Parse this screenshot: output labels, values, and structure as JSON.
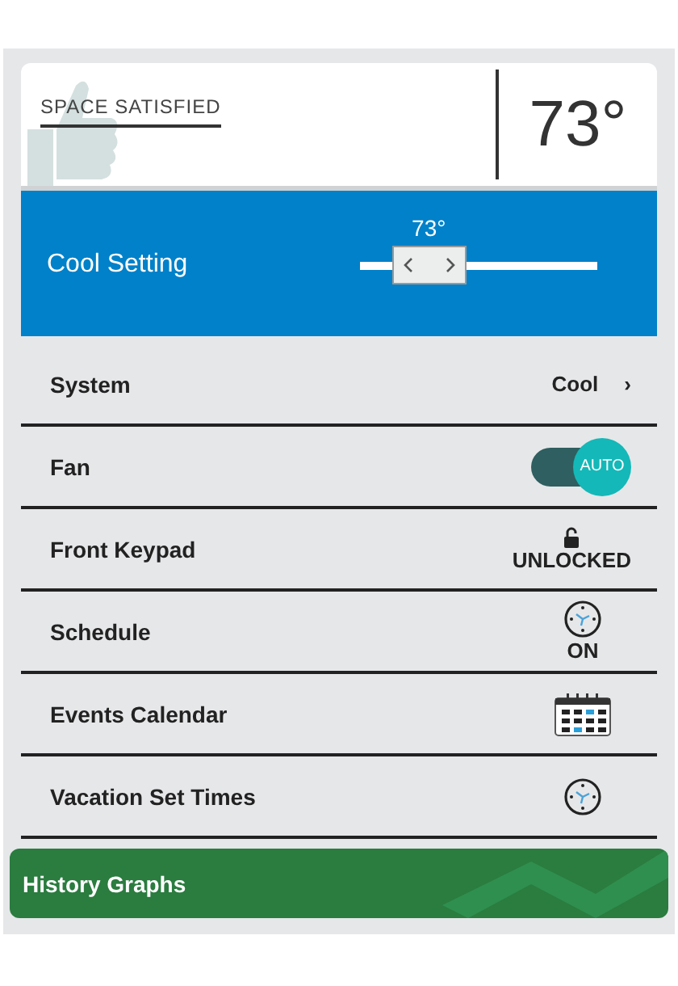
{
  "status": {
    "label": "SPACE SATISFIED",
    "temperature": "73°"
  },
  "setpoint": {
    "label": "Cool Setting",
    "reading": "73°"
  },
  "rows": [
    {
      "label": "System",
      "kind": "select",
      "value": "Cool",
      "chevron": "›"
    },
    {
      "label": "Fan",
      "kind": "toggle",
      "on": true,
      "value": "AUTO"
    },
    {
      "label": "Front Keypad",
      "kind": "lock",
      "value": "UNLOCKED"
    },
    {
      "label": "Schedule",
      "kind": "clock",
      "value": "ON"
    },
    {
      "label": "Events Calendar",
      "kind": "calendar"
    },
    {
      "label": "Vacation Set Times",
      "kind": "clock"
    }
  ],
  "history_button": "History Graphs"
}
